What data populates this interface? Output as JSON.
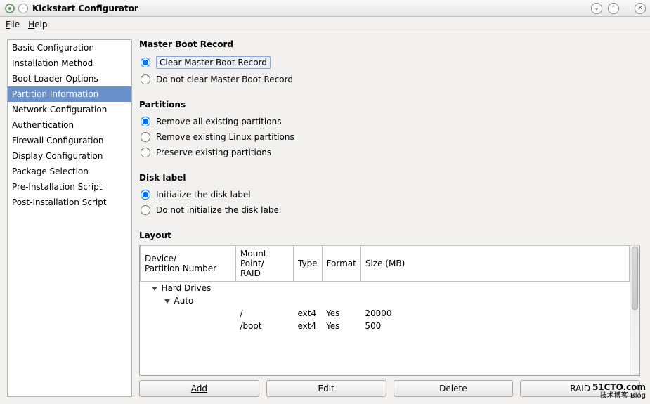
{
  "window": {
    "title": "Kickstart Configurator"
  },
  "menubar": {
    "file": "File",
    "file_accel": "F",
    "help": "Help",
    "help_accel": "H"
  },
  "sidebar": {
    "items": [
      {
        "label": "Basic Configuration"
      },
      {
        "label": "Installation Method"
      },
      {
        "label": "Boot Loader Options"
      },
      {
        "label": "Partition Information"
      },
      {
        "label": "Network Configuration"
      },
      {
        "label": "Authentication"
      },
      {
        "label": "Firewall Configuration"
      },
      {
        "label": "Display Configuration"
      },
      {
        "label": "Package Selection"
      },
      {
        "label": "Pre-Installation Script"
      },
      {
        "label": "Post-Installation Script"
      }
    ],
    "selected_index": 3
  },
  "sections": {
    "mbr": {
      "title": "Master Boot Record",
      "options": [
        {
          "label": "Clear Master Boot Record",
          "checked": true
        },
        {
          "label": "Do not clear Master Boot Record",
          "checked": false
        }
      ]
    },
    "partitions": {
      "title": "Partitions",
      "options": [
        {
          "label": "Remove all existing partitions",
          "checked": true
        },
        {
          "label": "Remove existing Linux partitions",
          "checked": false
        },
        {
          "label": "Preserve existing partitions",
          "checked": false
        }
      ]
    },
    "disklabel": {
      "title": "Disk label",
      "options": [
        {
          "label": "Initialize the disk label",
          "checked": true
        },
        {
          "label": "Do not initialize the disk label",
          "checked": false
        }
      ]
    },
    "layout": {
      "title": "Layout",
      "columns": {
        "device": "Device/\nPartition Number",
        "mount": "Mount Point/\nRAID",
        "type": "Type",
        "format": "Format",
        "size": "Size (MB)"
      },
      "tree": {
        "root_label": "Hard Drives",
        "child_label": "Auto",
        "rows": [
          {
            "mount": "/",
            "type": "ext4",
            "format": "Yes",
            "size": "20000"
          },
          {
            "mount": "/boot",
            "type": "ext4",
            "format": "Yes",
            "size": "500"
          }
        ]
      }
    }
  },
  "buttons": {
    "add": "Add",
    "edit": "Edit",
    "delete": "Delete",
    "raid": "RAID"
  },
  "watermark": {
    "line1": "51CTO.com",
    "line2": "技术博客    Blog"
  }
}
